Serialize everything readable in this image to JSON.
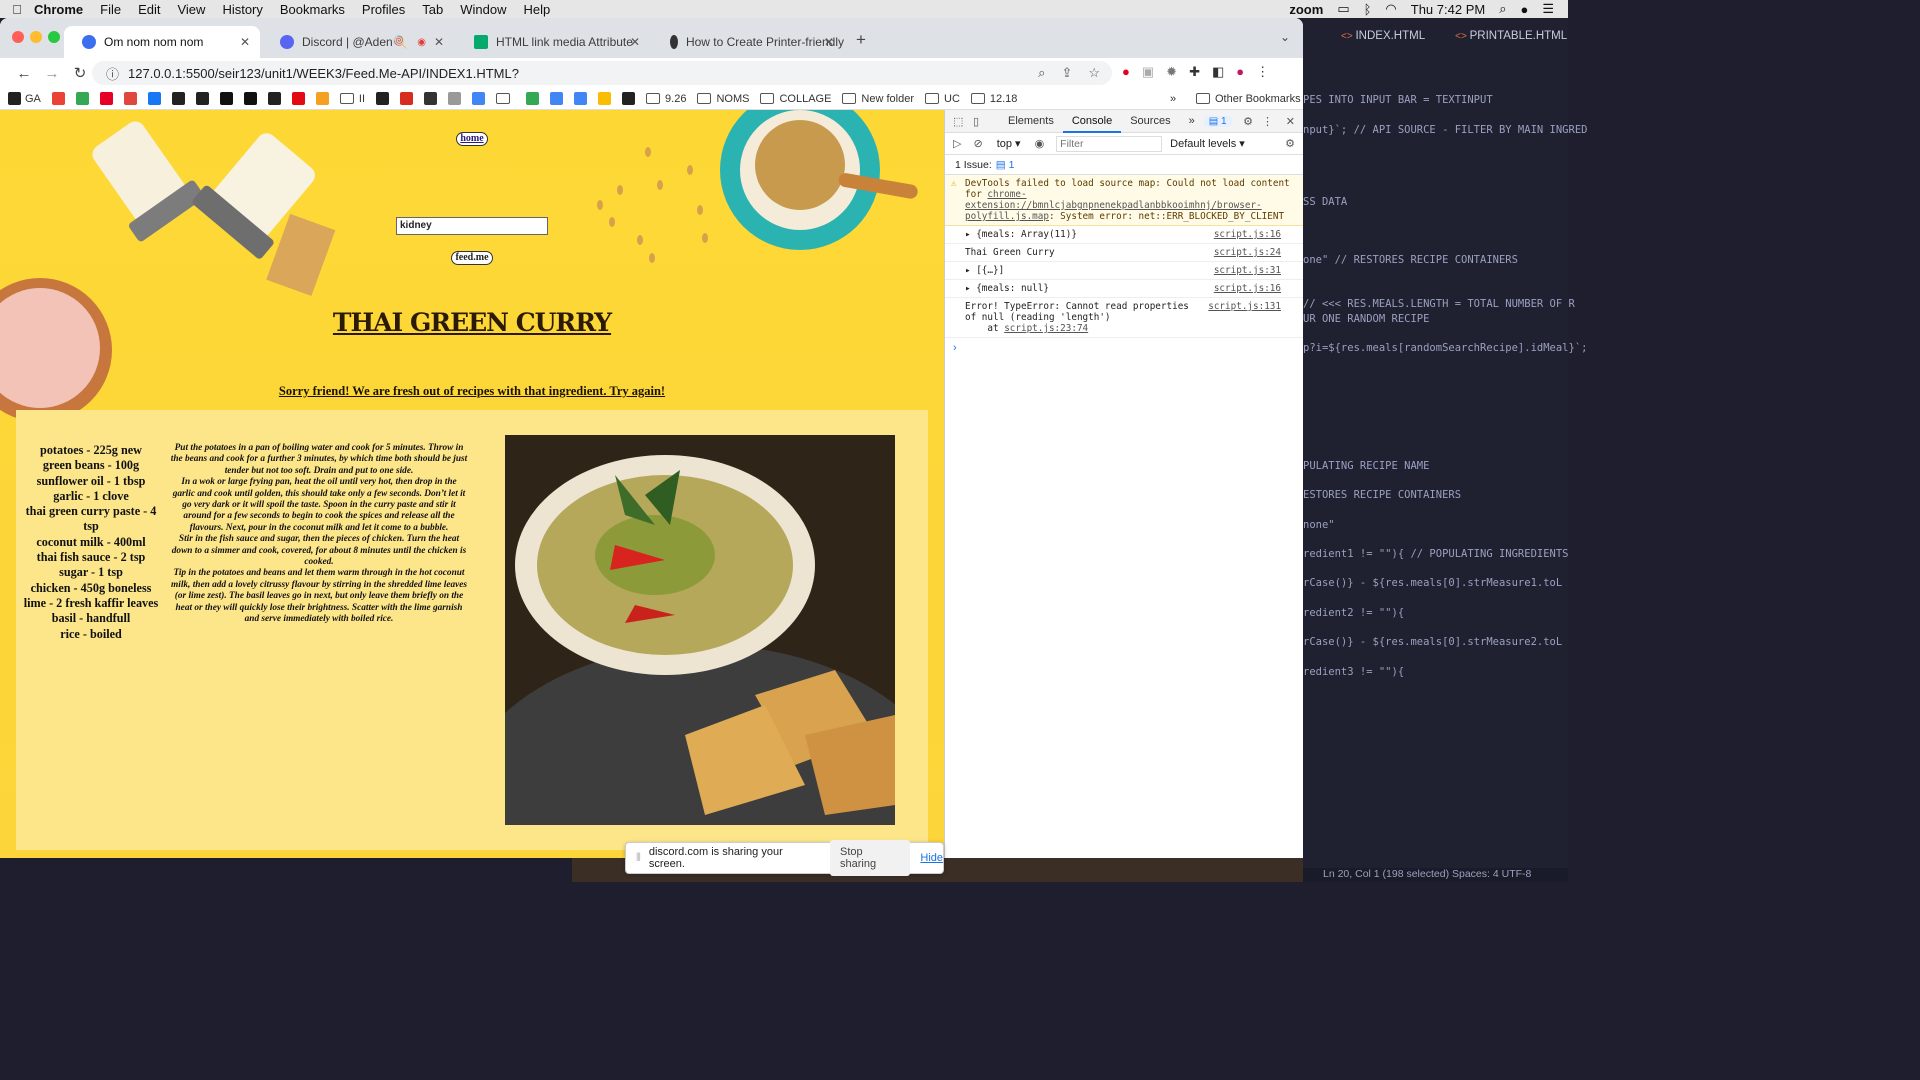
{
  "menubar": {
    "app": "Chrome",
    "items": [
      "File",
      "Edit",
      "View",
      "History",
      "Bookmarks",
      "Profiles",
      "Tab",
      "Window",
      "Help"
    ],
    "zoom": "zoom",
    "clock": "Thu 7:42 PM"
  },
  "tabs": [
    {
      "title": "Om nom nom nom",
      "color": "#3c6ff0"
    },
    {
      "title": "Discord | @Aden🍭",
      "color": "#5865f2"
    },
    {
      "title": "HTML link media Attribute",
      "color": "#04aa6d"
    },
    {
      "title": "How to Create Printer-friendly",
      "color": "#333333"
    }
  ],
  "address": {
    "url": "127.0.0.1:5500/seir123/unit1/WEEK3/Feed.Me-API/INDEX1.HTML?"
  },
  "bookmarks": [
    {
      "label": "GA",
      "color": "#222222"
    },
    {
      "label": "",
      "color": "#ea4335"
    },
    {
      "label": "",
      "color": "#34a853"
    },
    {
      "label": "",
      "color": "#e60023"
    },
    {
      "label": "",
      "color": "#e0483e"
    },
    {
      "label": "",
      "color": "#1877f2"
    },
    {
      "label": "",
      "color": "#222222"
    },
    {
      "label": "",
      "color": "#222222"
    },
    {
      "label": "",
      "color": "#111111"
    },
    {
      "label": "",
      "color": "#111111"
    },
    {
      "label": "",
      "color": "#222222"
    },
    {
      "label": "",
      "color": "#e50914"
    },
    {
      "label": "",
      "color": "#f4a020"
    },
    {
      "label": "II",
      "color": "folder"
    },
    {
      "label": "",
      "color": "#222222"
    },
    {
      "label": "",
      "color": "#d62d20"
    },
    {
      "label": "",
      "color": "#333333"
    },
    {
      "label": "",
      "color": "#999999"
    },
    {
      "label": "",
      "color": "#4285f4"
    },
    {
      "label": "",
      "color": "folder"
    },
    {
      "label": "",
      "color": "#34a853"
    },
    {
      "label": "",
      "color": "#4285f4"
    },
    {
      "label": "",
      "color": "#4285f4"
    },
    {
      "label": "",
      "color": "#fbbc04"
    },
    {
      "label": "",
      "color": "#222222"
    },
    {
      "label": "9.26",
      "color": "folder"
    },
    {
      "label": "NOMS",
      "color": "folder"
    },
    {
      "label": "COLLAGE",
      "color": "folder"
    },
    {
      "label": "New folder",
      "color": "folder"
    },
    {
      "label": "UC",
      "color": "folder"
    },
    {
      "label": "12.18",
      "color": "folder"
    }
  ],
  "bookmarks_more": "»",
  "other_bookmarks": "Other Bookmarks",
  "page": {
    "home_button": "home",
    "search_value": "kidney",
    "feed_button": "feed.me",
    "recipe_title": "THAI GREEN CURRY",
    "sorry_message": "Sorry friend! We are fresh out of recipes with that ingredient. Try again!",
    "ingredients": [
      "potatoes - 225g new",
      "green beans - 100g",
      "sunflower oil - 1 tbsp",
      "garlic - 1 clove",
      "thai green curry paste - 4 tsp",
      "coconut milk - 400ml",
      "thai fish sauce - 2 tsp",
      "sugar - 1 tsp",
      "chicken - 450g boneless",
      "lime - 2 fresh kaffir leaves",
      "basil - handfull",
      "rice - boiled"
    ],
    "instructions": [
      "Put the potatoes in a pan of boiling water and cook for 5 minutes. Throw in the beans and cook for a further 3 minutes, by which time both should be just tender but not too soft. Drain and put to one side.",
      "In a wok or large frying pan, heat the oil until very hot, then drop in the garlic and cook until golden, this should take only a few seconds. Don’t let it go very dark or it will spoil the taste. Spoon in the curry paste and stir it around for a few seconds to begin to cook the spices and release all the flavours. Next, pour in the coconut milk and let it come to a bubble.",
      "Stir in the fish sauce and sugar, then the pieces of chicken. Turn the heat down to a simmer and cook, covered, for about 8 minutes until the chicken is cooked.",
      "Tip in the potatoes and beans and let them warm through in the hot coconut milk, then add a lovely citrussy flavour by stirring in the shredded lime leaves (or lime zest). The basil leaves go in next, but only leave them briefly on the heat or they will quickly lose their brightness. Scatter with the lime garnish and serve immediately with boiled rice."
    ]
  },
  "devtools": {
    "tabs": [
      "Elements",
      "Console",
      "Sources",
      "»"
    ],
    "issue_badge": "1",
    "context": "top ▾",
    "filter_placeholder": "Filter",
    "levels": "Default levels ▾",
    "issues_label": "1 Issue:",
    "issues_count": "1",
    "console": [
      {
        "kind": "warn",
        "text": "DevTools failed to load source map: Could not load content for ",
        "link": "chrome-extension://bmnlcjabgnpnenekpadlanbbkooimhnj/browser-polyfill.js.map",
        "tail": ": System error: net::ERR_BLOCKED_BY_CLIENT",
        "src": ""
      },
      {
        "kind": "log",
        "text": "▸ {meals: Array(11)}",
        "src": "script.js:16"
      },
      {
        "kind": "log",
        "text": "Thai Green Curry",
        "src": "script.js:24"
      },
      {
        "kind": "log",
        "text": "▸ [{…}]",
        "src": "script.js:31"
      },
      {
        "kind": "log",
        "text": "▸ {meals: null}",
        "src": "script.js:16"
      },
      {
        "kind": "err",
        "text": "Error! TypeError: Cannot read properties of null (reading 'length')\n    at ",
        "link": "script.js:23:74",
        "tail": "",
        "src": "script.js:131"
      }
    ],
    "prompt": "›"
  },
  "share": {
    "message": "discord.com is sharing your screen.",
    "stop": "Stop sharing",
    "hide": "Hide"
  },
  "vscode": {
    "tabs": [
      "INDEX.HTML",
      "PRINTABLE.HTML"
    ],
    "lines": [
      "PES INTO INPUT BAR = TEXTINPUT",
      "nput}`; // API SOURCE - FILTER BY MAIN INGRED",
      "SS DATA",
      "one\"  // RESTORES RECIPE CONTAINERS",
      "  // <<< RES.MEALS.LENGTH = TOTAL NUMBER OF R",
      "UR ONE RANDOM RECIPE",
      "p?i=${res.meals[randomSearchRecipe].idMeal}`;",
      "PULATING RECIPE NAME",
      "ESTORES RECIPE CONTAINERS",
      "none\"",
      "redient1 != \"\"){    // POPULATING INGREDIENTS",
      "rCase()}   -   ${res.meals[0].strMeasure1.toL",
      "redient2 != \"\"){",
      "rCase()}   -   ${res.meals[0].strMeasure2.toL",
      "redient3 != \"\"){"
    ],
    "status": "Ln 20, Col 1 (198 selected)   Spaces: 4   UTF-8"
  },
  "colors": {
    "page_yellow": "#fdd835",
    "card": "#fde68a",
    "accent_blue": "#1a73e8"
  }
}
